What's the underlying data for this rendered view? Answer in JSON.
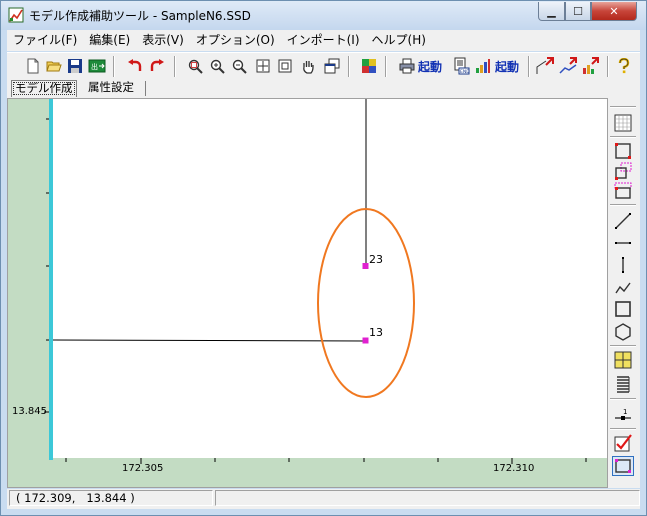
{
  "window": {
    "title": "モデル作成補助ツール - SampleN6.SSD"
  },
  "menubar": {
    "items": [
      "ファイル(F)",
      "編集(E)",
      "表示(V)",
      "オプション(O)",
      "インポート(I)",
      "ヘルプ(H)"
    ]
  },
  "toolbar": {
    "launch1_label": "起動",
    "launch2_label": "起動"
  },
  "tabs": [
    {
      "label": "モデル作成"
    },
    {
      "label": "属性設定"
    }
  ],
  "canvas": {
    "y_tick_label": "13.845",
    "x_tick_labels": [
      "172.305",
      "172.310"
    ],
    "points": [
      {
        "label": "23"
      },
      {
        "label": "13"
      }
    ],
    "highlight_color": "#f07820",
    "node_color": "#e020d0",
    "axis_accent_color": "#3cc8d8",
    "margin_color": "#c3dcc3"
  },
  "statusbar": {
    "coordinates": "( 172.309,   13.844 )",
    "aux": ""
  }
}
